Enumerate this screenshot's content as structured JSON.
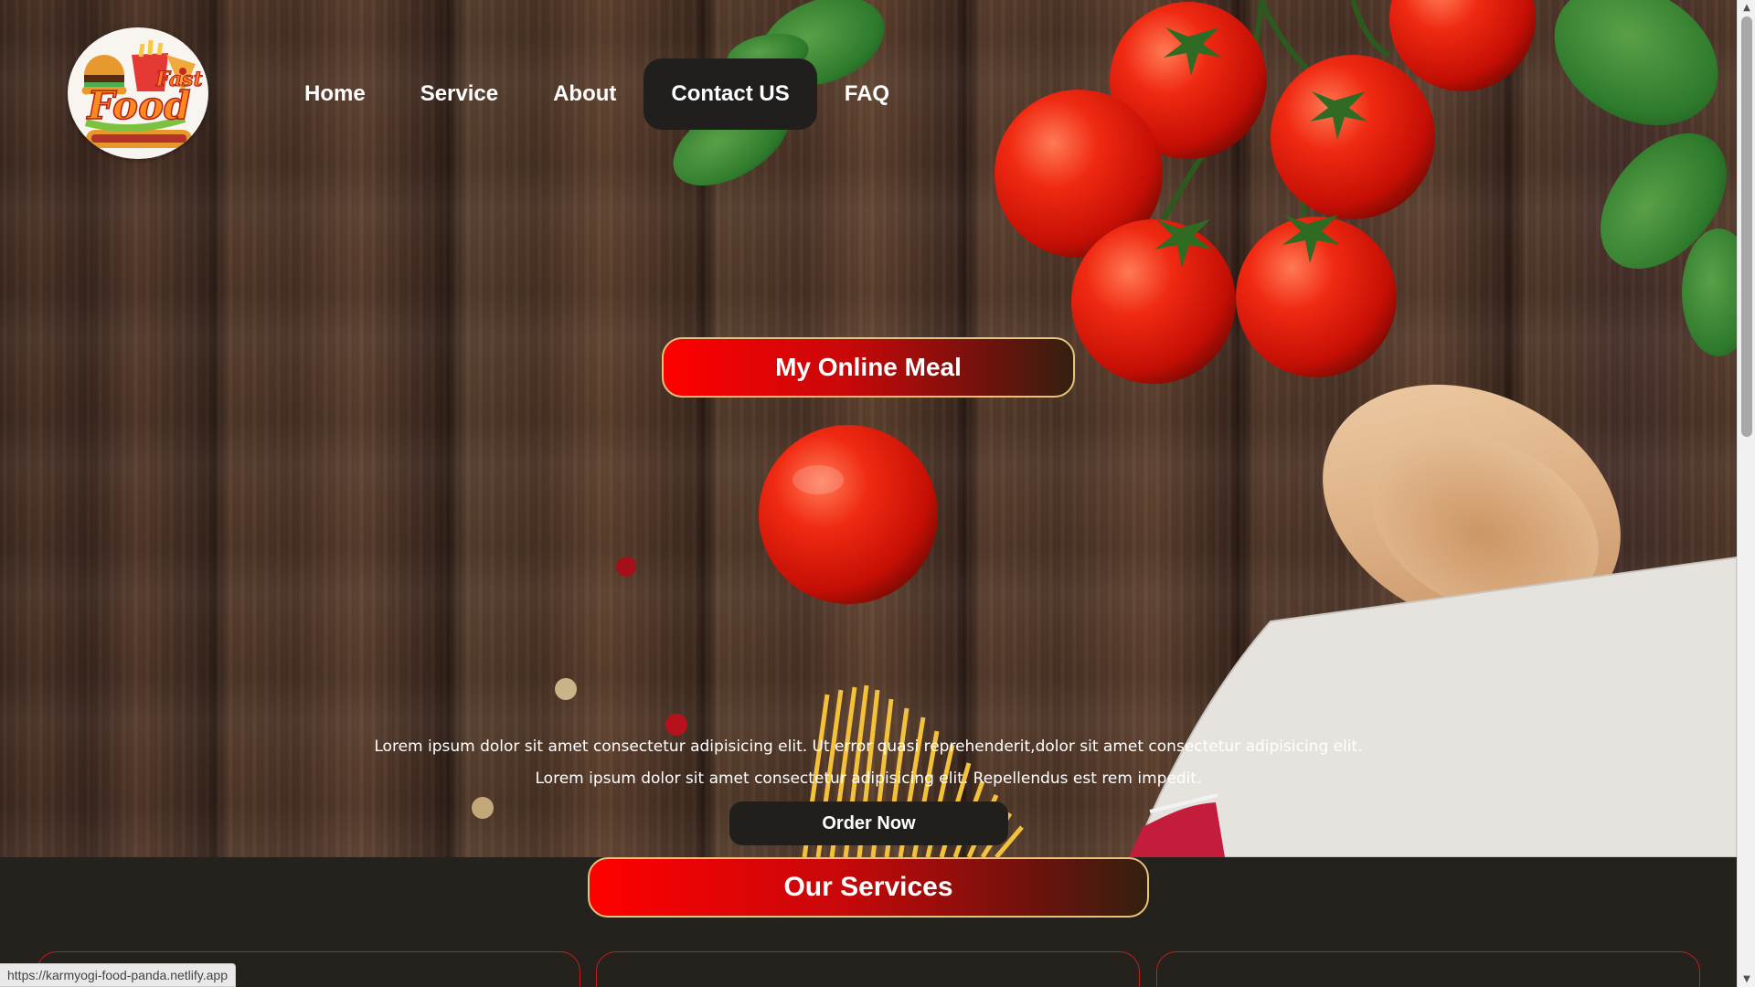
{
  "logo": {
    "text_top": "Fast",
    "text_bottom": "Food"
  },
  "nav": {
    "items": [
      {
        "label": "Home"
      },
      {
        "label": "Service"
      },
      {
        "label": "About"
      },
      {
        "label": "Contact US"
      },
      {
        "label": "FAQ"
      }
    ],
    "active": "Contact US"
  },
  "hero": {
    "title": "My Online Meal",
    "line1": "Lorem ipsum dolor sit amet consectetur adipisicing elit. Ut error quasi reprehenderit,dolor sit amet consectetur adipisicing elit.",
    "line2": "Lorem ipsum dolor sit amet consectetur adipisicing elit. Repellendus est rem impedit.",
    "order_button": "Order Now"
  },
  "services": {
    "title": "Our Services"
  },
  "status_bar": {
    "url": "https://karmyogi-food-panda.netlify.app"
  },
  "scrollbar": {
    "up_icon": "▲",
    "down_icon": "▼"
  },
  "colors": {
    "accent_red": "#ff0000",
    "pill_border": "#e8c17a",
    "dark_bg": "#25221e",
    "card_border": "#c21f1f"
  }
}
